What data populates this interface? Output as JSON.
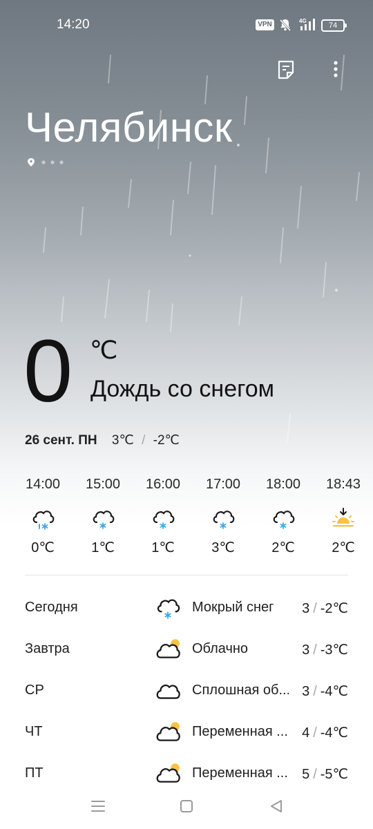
{
  "status_bar": {
    "time": "14:20",
    "vpn_label": "VPN",
    "network": "4G",
    "battery_level": "74",
    "icons": [
      "vpn-badge",
      "bell-muted-icon",
      "signal-4g-icon",
      "battery-icon"
    ]
  },
  "header": {
    "icons": [
      "forecast-notes-icon",
      "more-vertical-icon"
    ]
  },
  "location": {
    "city": "Челябинск",
    "page_count": 4,
    "current_page": 1
  },
  "current": {
    "temperature": "0",
    "unit": "℃",
    "condition": "Дождь со снегом",
    "date": "26 сент. ПН",
    "high": "3℃",
    "low": "-2℃"
  },
  "hourly": [
    {
      "time": "14:00",
      "icon": "cloud-sleet-icon",
      "temp": "0℃"
    },
    {
      "time": "15:00",
      "icon": "cloud-snow-icon",
      "temp": "1℃"
    },
    {
      "time": "16:00",
      "icon": "cloud-snow-icon",
      "temp": "1℃"
    },
    {
      "time": "17:00",
      "icon": "cloud-snow-icon",
      "temp": "3℃"
    },
    {
      "time": "18:00",
      "icon": "cloud-snow-icon",
      "temp": "2℃"
    },
    {
      "time": "18:43",
      "icon": "sunset-icon",
      "temp": "2℃"
    }
  ],
  "daily": [
    {
      "day": "Сегодня",
      "icon": "cloud-snow-icon",
      "condition": "Мокрый снег",
      "high": "3",
      "low": "-2℃"
    },
    {
      "day": "Завтра",
      "icon": "cloud-sun-icon",
      "condition": "Облачно",
      "high": "3",
      "low": "-3℃"
    },
    {
      "day": "СР",
      "icon": "cloud-icon",
      "condition": "Сплошная об...",
      "high": "3",
      "low": "-4℃"
    },
    {
      "day": "ЧТ",
      "icon": "cloud-sun-icon",
      "condition": "Переменная ...",
      "high": "4",
      "low": "-4℃"
    },
    {
      "day": "ПТ",
      "icon": "cloud-sun-icon",
      "condition": "Переменная ...",
      "high": "5",
      "low": "-5℃"
    }
  ],
  "temp_separator": "/",
  "colors": {
    "snow_flake": "#3fa9e8",
    "sun": "#f6c343",
    "icon_stroke": "#1a1a1a"
  },
  "navbar": {
    "icons": [
      "recent-apps-icon",
      "home-icon",
      "back-icon"
    ]
  }
}
